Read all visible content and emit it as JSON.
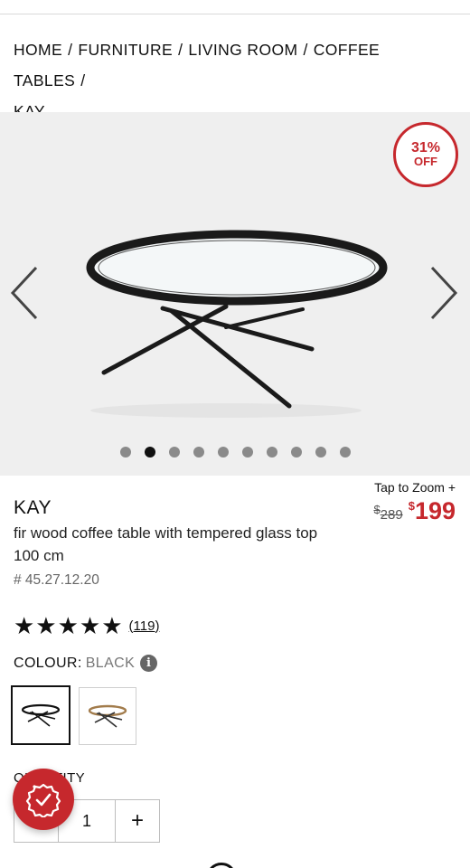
{
  "breadcrumb": {
    "items": [
      "Home",
      "Furniture",
      "Living Room",
      "Coffee Tables",
      "Kay"
    ],
    "separator": "/"
  },
  "gallery": {
    "discount_pct": "31%",
    "discount_off": "OFF",
    "dot_count": 10,
    "active_dot_index": 1,
    "image_alt_icon": "coffee-table-image"
  },
  "product": {
    "name": "KAY",
    "description": "fir wood coffee table with tempered glass top 100 cm",
    "sku": "# 45.27.12.20",
    "tap_to_zoom": "Tap to Zoom +",
    "price_was_currency": "$",
    "price_was": "289",
    "price_now_currency": "$",
    "price_now": "199",
    "rating_stars": "★★★★★",
    "rating_value": 5,
    "review_count": "(119)"
  },
  "colour": {
    "label": "COLOUR:",
    "selected": "BLACK",
    "info_glyph": "i",
    "options": [
      "black",
      "natural"
    ]
  },
  "quantity": {
    "label": "QUANTITY",
    "value": "1",
    "minus": "−",
    "plus": "+"
  },
  "colors": {
    "accent": "#c6282d",
    "gallery_bg": "#efefef"
  }
}
